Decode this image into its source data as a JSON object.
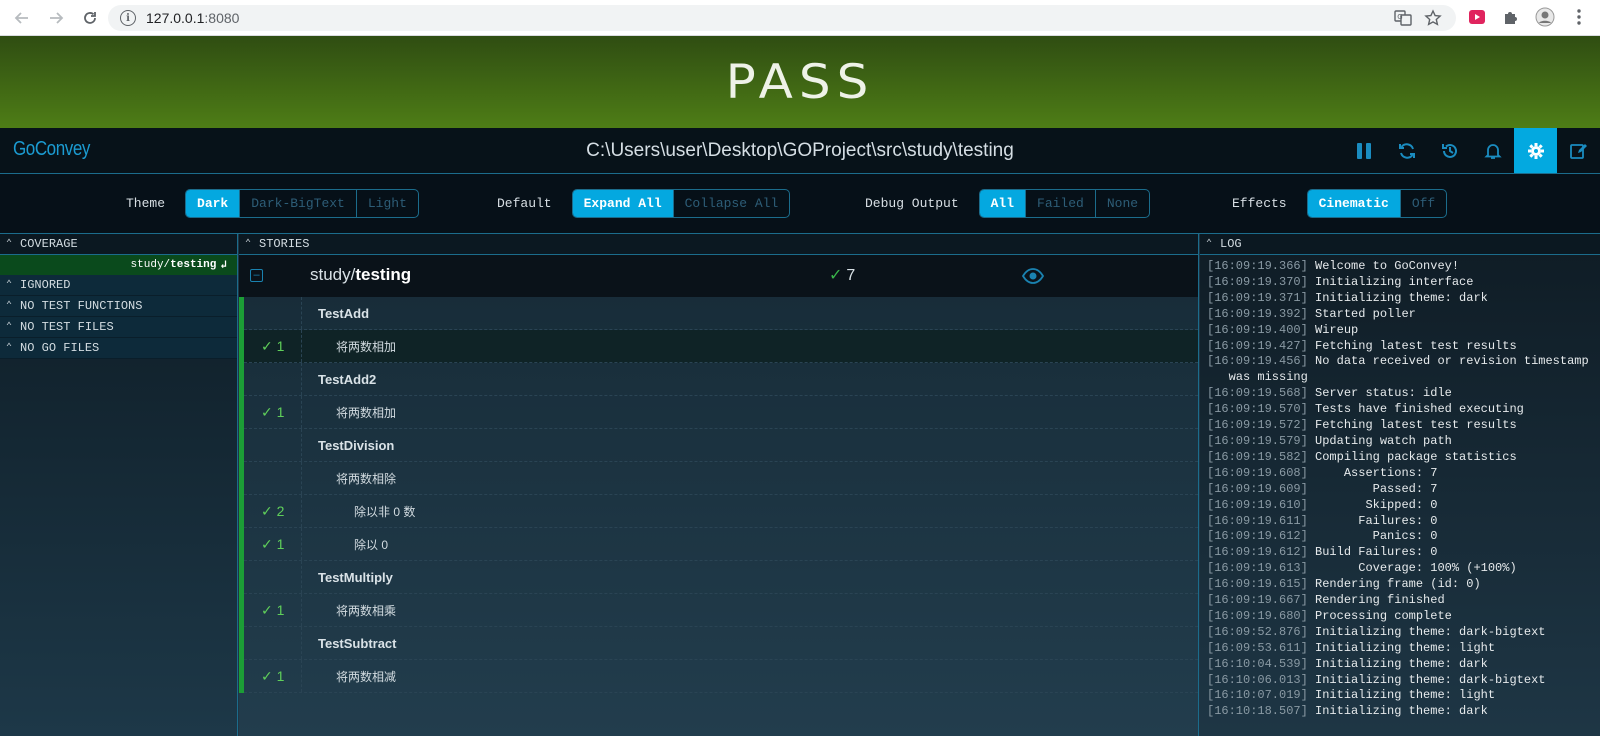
{
  "browser": {
    "url_host": "127.0.0.1",
    "url_port": ":8080"
  },
  "banner": {
    "status": "PASS"
  },
  "header": {
    "logo": "GoConvey",
    "path": "C:\\Users\\user\\Desktop\\GOProject\\src\\study\\testing"
  },
  "settings": {
    "theme": {
      "label": "Theme",
      "options": [
        "Dark",
        "Dark-BigText",
        "Light"
      ],
      "selected": "Dark"
    },
    "default": {
      "label": "Default",
      "options": [
        "Expand All",
        "Collapse All"
      ],
      "selected": "Expand All"
    },
    "debug": {
      "label": "Debug Output",
      "options": [
        "All",
        "Failed",
        "None"
      ],
      "selected": "All"
    },
    "effects": {
      "label": "Effects",
      "options": [
        "Cinematic",
        "Off"
      ],
      "selected": "Cinematic"
    }
  },
  "coverage": {
    "title": "COVERAGE",
    "package_prefix": "study/",
    "package_name": "testing",
    "sections": [
      "IGNORED",
      "NO TEST FUNCTIONS",
      "NO TEST FILES",
      "NO GO FILES"
    ]
  },
  "stories": {
    "title": "STORIES",
    "package_prefix": "study/",
    "package_name": "testing",
    "pass_count": "7",
    "rows": [
      {
        "count": "",
        "text": "TestAdd",
        "kind": "test",
        "indent": 1
      },
      {
        "count": "1",
        "text": "将两数相加",
        "kind": "assert",
        "indent": 2
      },
      {
        "count": "",
        "text": "TestAdd2",
        "kind": "test",
        "indent": 1
      },
      {
        "count": "1",
        "text": "将两数相加",
        "kind": "assert",
        "indent": 2
      },
      {
        "count": "",
        "text": "TestDivision",
        "kind": "test",
        "indent": 1
      },
      {
        "count": "",
        "text": "将两数相除",
        "kind": "assert",
        "indent": 2
      },
      {
        "count": "2",
        "text": "除以非 0 数",
        "kind": "assert",
        "indent": 3
      },
      {
        "count": "1",
        "text": "除以 0",
        "kind": "assert",
        "indent": 3
      },
      {
        "count": "",
        "text": "TestMultiply",
        "kind": "test",
        "indent": 1
      },
      {
        "count": "1",
        "text": "将两数相乘",
        "kind": "assert",
        "indent": 2
      },
      {
        "count": "",
        "text": "TestSubtract",
        "kind": "test",
        "indent": 1
      },
      {
        "count": "1",
        "text": "将两数相减",
        "kind": "assert",
        "indent": 2
      }
    ]
  },
  "log": {
    "title": "LOG",
    "lines": [
      [
        "[16:09:19.366]",
        " Welcome to GoConvey!"
      ],
      [
        "[16:09:19.370]",
        " Initializing interface"
      ],
      [
        "[16:09:19.371]",
        " Initializing theme: dark"
      ],
      [
        "[16:09:19.392]",
        " Started poller"
      ],
      [
        "[16:09:19.400]",
        " Wireup"
      ],
      [
        "[16:09:19.427]",
        " Fetching latest test results"
      ],
      [
        "[16:09:19.456]",
        " No data received or revision timestamp"
      ],
      [
        "",
        "   was missing"
      ],
      [
        "[16:09:19.568]",
        " Server status: idle"
      ],
      [
        "[16:09:19.570]",
        " Tests have finished executing"
      ],
      [
        "[16:09:19.572]",
        " Fetching latest test results"
      ],
      [
        "[16:09:19.579]",
        " Updating watch path"
      ],
      [
        "[16:09:19.582]",
        " Compiling package statistics"
      ],
      [
        "[16:09:19.608]",
        "     Assertions: 7"
      ],
      [
        "[16:09:19.609]",
        "         Passed: 7"
      ],
      [
        "[16:09:19.610]",
        "        Skipped: 0"
      ],
      [
        "[16:09:19.611]",
        "       Failures: 0"
      ],
      [
        "[16:09:19.612]",
        "         Panics: 0"
      ],
      [
        "[16:09:19.612]",
        " Build Failures: 0"
      ],
      [
        "[16:09:19.613]",
        "       Coverage: 100% (+100%)"
      ],
      [
        "[16:09:19.615]",
        " Rendering frame (id: 0)"
      ],
      [
        "[16:09:19.667]",
        " Rendering finished"
      ],
      [
        "[16:09:19.680]",
        " Processing complete"
      ],
      [
        "[16:09:52.876]",
        " Initializing theme: dark-bigtext"
      ],
      [
        "[16:09:53.611]",
        " Initializing theme: light"
      ],
      [
        "[16:10:04.539]",
        " Initializing theme: dark"
      ],
      [
        "[16:10:06.013]",
        " Initializing theme: dark-bigtext"
      ],
      [
        "[16:10:07.019]",
        " Initializing theme: light"
      ],
      [
        "[16:10:18.507]",
        " Initializing theme: dark"
      ]
    ]
  },
  "colors": {
    "accent": "#04a8e0",
    "pass_green": "#39b54a",
    "banner_top": "#2f4d12",
    "banner_bottom": "#4e7d16"
  }
}
